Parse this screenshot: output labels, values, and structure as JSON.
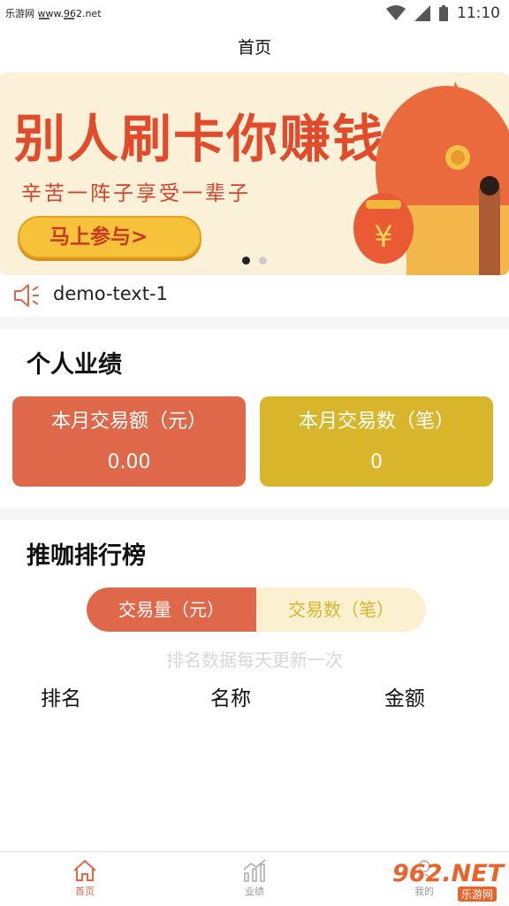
{
  "status_bar": {
    "site_label": "乐游网 www.962.net",
    "time": "11:10"
  },
  "header": {
    "title": "首页"
  },
  "banner": {
    "headline": "别人刷卡你赚钱",
    "subline": "辛苦一阵子享受一辈子",
    "cta_label": "马上参与>",
    "pager": {
      "total": 2,
      "active": 1
    }
  },
  "notice": {
    "text": "demo-text-1",
    "icon": "speaker-icon"
  },
  "performance": {
    "title": "个人业绩",
    "cards": [
      {
        "label": "本月交易额（元）",
        "value": "0.00",
        "color": "#e0684a"
      },
      {
        "label": "本月交易数（笔）",
        "value": "0",
        "color": "#d8b52a"
      }
    ]
  },
  "ranking": {
    "title": "推咖排行榜",
    "tabs": [
      {
        "label": "交易量（元）",
        "active": true
      },
      {
        "label": "交易数（笔）",
        "active": false
      }
    ],
    "hint": "排名数据每天更新一次",
    "columns": [
      "排名",
      "名称",
      "金额"
    ]
  },
  "tab_bar": {
    "items": [
      {
        "label": "首页",
        "icon": "home-icon",
        "active": true
      },
      {
        "label": "业绩",
        "icon": "chart-icon",
        "active": false
      },
      {
        "label": "我的",
        "icon": "user-icon",
        "active": false
      }
    ]
  },
  "watermark": {
    "logo": "962.NET",
    "sub": "乐游网"
  },
  "colors": {
    "accent_red": "#e0684a",
    "accent_gold": "#d8b52a"
  }
}
